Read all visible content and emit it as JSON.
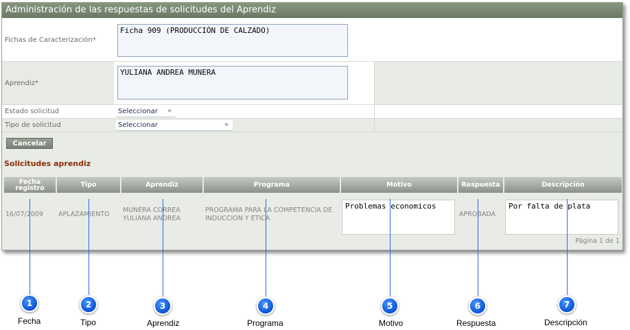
{
  "window": {
    "title": "Administración de las respuestas de solicitudes del Aprendiz"
  },
  "form": {
    "fichas_label": "Fichas de Caracterización*",
    "fichas_value": "Ficha 909 (PRODUCCIÓN DE CALZADO)",
    "aprendiz_label": "Aprendiz*",
    "aprendiz_value": "YULIANA ANDREA MUNERA",
    "estado_label": "Estado solicitud",
    "estado_value": "Seleccionar",
    "tipo_label": "Tipo de solicitud",
    "tipo_value": "Seleccionar",
    "cancel_label": "Cancelar"
  },
  "section_title": "Solicitudes aprendiz",
  "table": {
    "headers": [
      "Fecha registro",
      "Tipo",
      "Aprendiz",
      "Programa",
      "Motivo",
      "Respuesta",
      "Descripción"
    ],
    "row": {
      "fecha": "16/07/2009",
      "tipo": "APLAZAMIENTO",
      "aprendiz": "MUNERA CORREA YULIANA ANDREA",
      "programa": "PROGRAMA PARA LA COMPETENCIA DE INDUCCION Y ETICA",
      "motivo": "Problemas economicos",
      "respuesta": "APROBADA",
      "descripcion": "Por falta de plata"
    },
    "pager": "Página 1 de 1"
  },
  "callouts": [
    {
      "number": "1",
      "label": "Fecha"
    },
    {
      "number": "2",
      "label": "Tipo"
    },
    {
      "number": "3",
      "label": "Aprendiz"
    },
    {
      "number": "4",
      "label": "Programa"
    },
    {
      "number": "5",
      "label": "Motivo"
    },
    {
      "number": "6",
      "label": "Respuesta"
    },
    {
      "number": "7",
      "label": "Descripción"
    }
  ],
  "colors": {
    "callout": "#0a52d6",
    "section_title": "#8b2e07",
    "header_bar": "#6d7a65"
  }
}
